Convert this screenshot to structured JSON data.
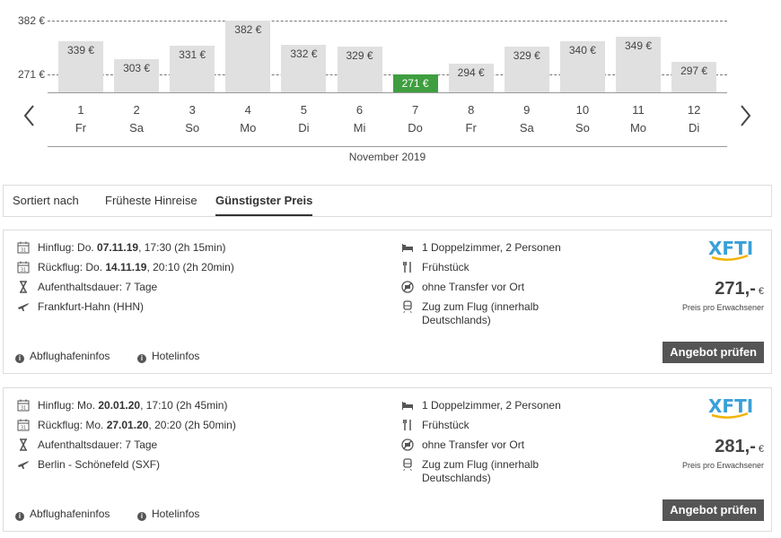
{
  "chart_data": {
    "type": "bar",
    "title": "",
    "xlabel": "November 2019",
    "ylabel": "",
    "ylim": [
      271,
      382
    ],
    "y_ticks": [
      "382 €",
      "271 €"
    ],
    "y_tick_values": [
      382,
      271
    ],
    "categories": [
      "1",
      "2",
      "3",
      "4",
      "5",
      "6",
      "7",
      "8",
      "9",
      "10",
      "11",
      "12"
    ],
    "weekdays": [
      "Fr",
      "Sa",
      "So",
      "Mo",
      "Di",
      "Mi",
      "Do",
      "Fr",
      "Sa",
      "So",
      "Mo",
      "Di"
    ],
    "values": [
      339,
      303,
      331,
      382,
      332,
      329,
      271,
      294,
      329,
      340,
      349,
      297
    ],
    "labels": [
      "339 €",
      "303 €",
      "331 €",
      "382 €",
      "332 €",
      "329 €",
      "271 €",
      "294 €",
      "329 €",
      "340 €",
      "349 €",
      "297 €"
    ],
    "highlight_index": 6,
    "colors": {
      "bar": "#e0e0e0",
      "highlight": "#3f9e3f"
    }
  },
  "nav": {
    "prev_icon": "chevron-left-icon",
    "next_icon": "chevron-right-icon"
  },
  "sort": {
    "label": "Sortiert nach",
    "options": [
      "Früheste Hinreise",
      "Günstigster Preis"
    ],
    "active": 1
  },
  "offers": [
    {
      "outbound_prefix": "Hinflug: Do. ",
      "outbound_date": "07.11.19",
      "outbound_suffix": ", 17:30 (2h 15min)",
      "return_prefix": "Rückflug: Do. ",
      "return_date": "14.11.19",
      "return_suffix": ", 20:10 (2h 20min)",
      "stay": "Aufenthaltsdauer: 7 Tage",
      "airport": "Frankfurt-Hahn (HHN)",
      "room": "1 Doppelzimmer, 2 Personen",
      "board": "Frühstück",
      "transfer": "ohne Transfer vor Ort",
      "train_line1": "Zug zum Flug (innerhalb",
      "train_line2": "Deutschlands)",
      "logo_text": "XFTI",
      "price": "271,-",
      "currency": "€",
      "price_note": "Preis pro Erwachsener",
      "cta": "Angebot prüfen",
      "airport_info": "Abflughafeninfos",
      "hotel_info": "Hotelinfos"
    },
    {
      "outbound_prefix": "Hinflug: Mo. ",
      "outbound_date": "20.01.20",
      "outbound_suffix": ", 17:10 (2h 45min)",
      "return_prefix": "Rückflug: Mo. ",
      "return_date": "27.01.20",
      "return_suffix": ", 20:20 (2h 50min)",
      "stay": "Aufenthaltsdauer: 7 Tage",
      "airport": "Berlin - Schönefeld (SXF)",
      "room": "1 Doppelzimmer, 2 Personen",
      "board": "Frühstück",
      "transfer": "ohne Transfer vor Ort",
      "train_line1": "Zug zum Flug (innerhalb",
      "train_line2": "Deutschlands)",
      "logo_text": "XFTI",
      "price": "281,-",
      "currency": "€",
      "price_note": "Preis pro Erwachsener",
      "cta": "Angebot prüfen",
      "airport_info": "Abflughafeninfos",
      "hotel_info": "Hotelinfos"
    }
  ]
}
